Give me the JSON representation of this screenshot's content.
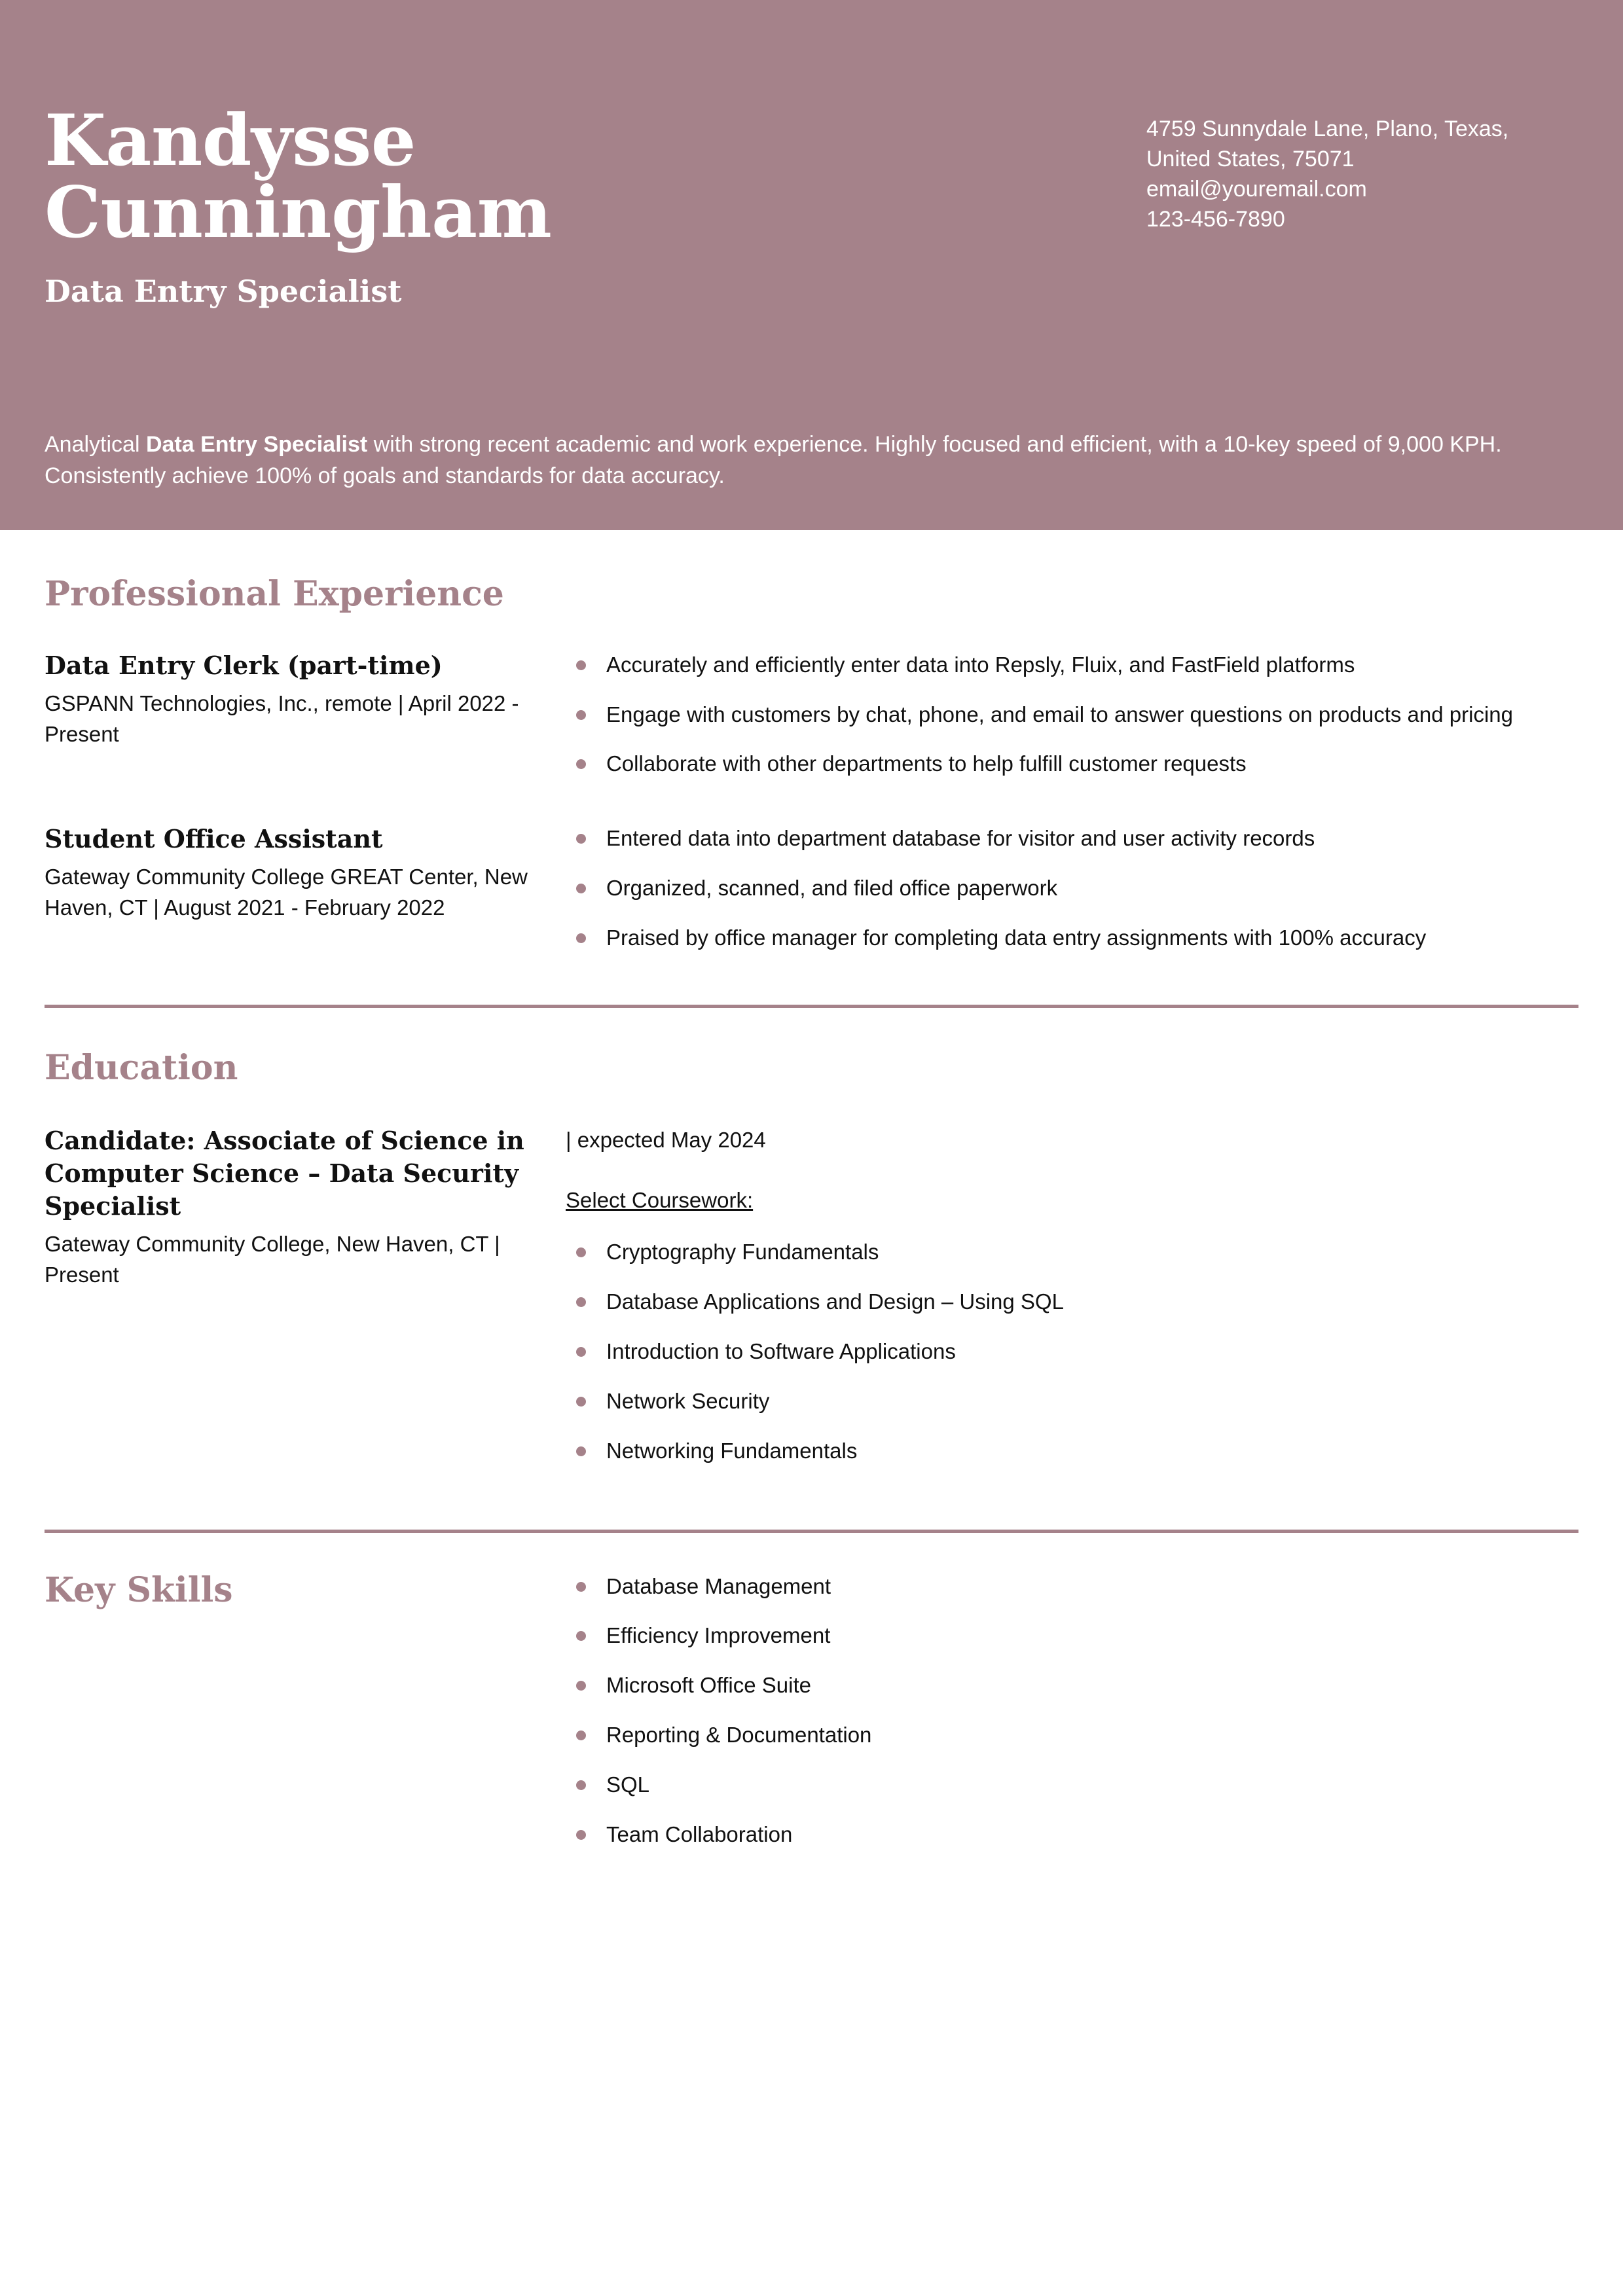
{
  "theme": {
    "accent": "#a5828a",
    "header_text": "#ffffff",
    "body_text": "#111111",
    "page_background": "#ffffff"
  },
  "header": {
    "name": "Kandysse Cunningham",
    "name_line1": "Kandysse",
    "name_line2": "Cunningham",
    "job_title": "Data Entry Specialist",
    "contact": [
      "4759 Sunnydale Lane, Plano, Texas,",
      "United States, 75071",
      "email@youremail.com",
      "123-456-7890"
    ],
    "summary_part1": "Analytical ",
    "summary_bold": "Data Entry Specialist",
    "summary_part2": " with strong recent academic and work experience. Highly focused and efficient, with a 10-key speed of 9,000 KPH. Consistently achieve 100% of goals and standards for data accuracy."
  },
  "sections": {
    "experience": {
      "title": "Professional Experience",
      "entries": [
        {
          "title": "Data Entry Clerk (part-time)",
          "meta": "GSPANN Technologies, Inc., remote | April 2022 - Present",
          "bullets": [
            "Accurately and efficiently enter data into Repsly, Fluix, and FastField platforms",
            "Engage with customers by chat, phone, and email to answer questions on products and pricing",
            "Collaborate with other departments to help fulfill customer requests"
          ]
        },
        {
          "title": "Student Office Assistant",
          "meta": "Gateway Community College GREAT Center, New Haven, CT | August 2021 - February 2022",
          "bullets": [
            "Entered data into department database for visitor and user activity records",
            "Organized, scanned, and filed office paperwork",
            "Praised by office manager for completing data entry assignments with 100% accuracy"
          ]
        }
      ]
    },
    "education": {
      "title": "Education",
      "entries": [
        {
          "title": "Candidate: Associate of Science in Computer Science – Data Security Specialist",
          "meta": "Gateway Community College, New Haven, CT | Present",
          "expected": "| expected May 2024",
          "coursework_label": "Select Coursework:",
          "coursework": [
            "Cryptography Fundamentals",
            "Database Applications and Design – Using SQL",
            "Introduction to Software Applications",
            "Network Security",
            "Networking Fundamentals"
          ]
        }
      ]
    },
    "skills": {
      "title": "Key Skills",
      "items": [
        "Database Management",
        "Efficiency Improvement",
        "Microsoft Office Suite",
        "Reporting & Documentation",
        "SQL",
        "Team Collaboration"
      ]
    }
  }
}
